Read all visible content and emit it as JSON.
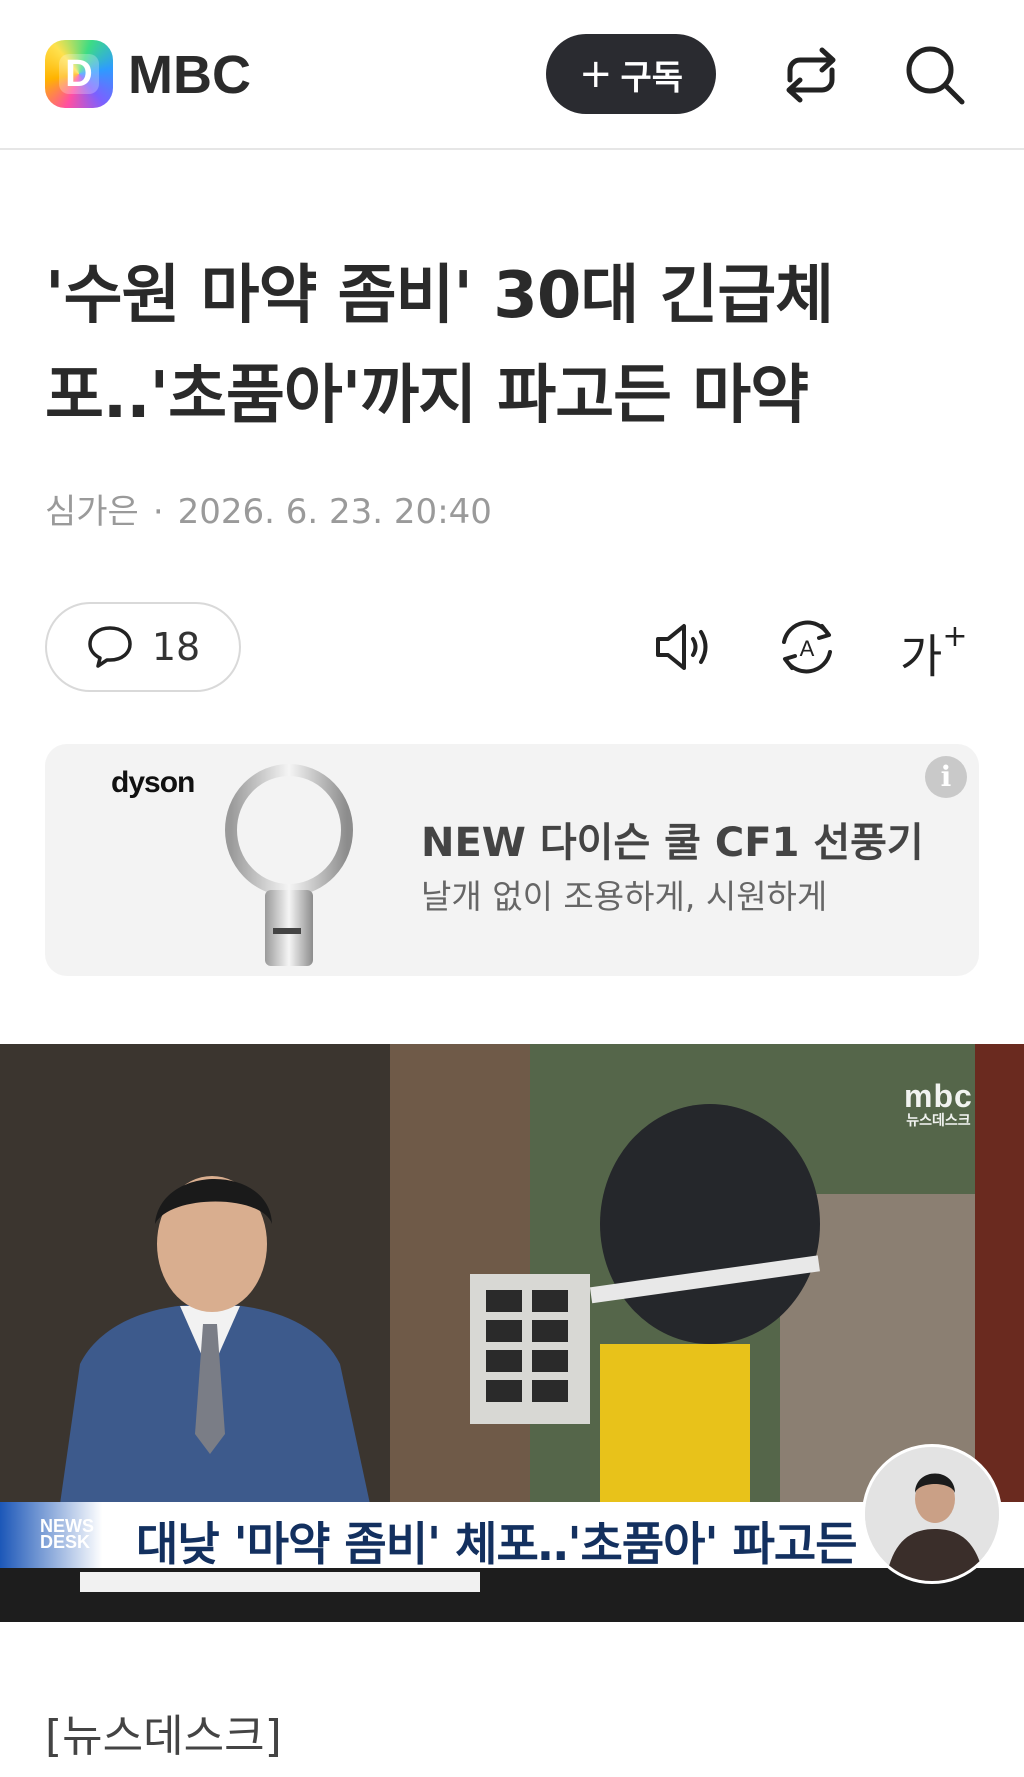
{
  "header": {
    "logo_letter": "D",
    "brand": "MBC",
    "subscribe_plus": "+",
    "subscribe_label": "구독"
  },
  "article": {
    "headline_line1": "'수원 마약 좀비' 30대 긴급체",
    "headline_line2": "포..'초품아'까지 파고든 마약",
    "author": "심가은",
    "separator": "·",
    "datetime": "2026. 6. 23. 20:40"
  },
  "toolbar": {
    "comment_count": "18",
    "font_size_label": "가",
    "font_size_plus": "+"
  },
  "ad": {
    "brand": "dyson",
    "title": "NEW 다이슨 쿨 CF1 선풍기",
    "subtitle": "날개 없이 조용하게, 시원하게",
    "info_symbol": "i"
  },
  "video": {
    "bug_logo": "mbc",
    "bug_sub": "뉴스데스크",
    "caption_logo_line1": "NEWS",
    "caption_logo_line2": "DESK",
    "caption": "대낮 '마약 좀비' 체포‥'초품아' 파고든 마약"
  },
  "body": {
    "section_tag": "[뉴스데스크]"
  },
  "colors": {
    "subscribe_bg": "#2a2b30",
    "headline": "#2a2a2a",
    "byline": "#9a9a9a",
    "ad_bg": "#f3f3f3",
    "caption_text": "#13305f"
  }
}
